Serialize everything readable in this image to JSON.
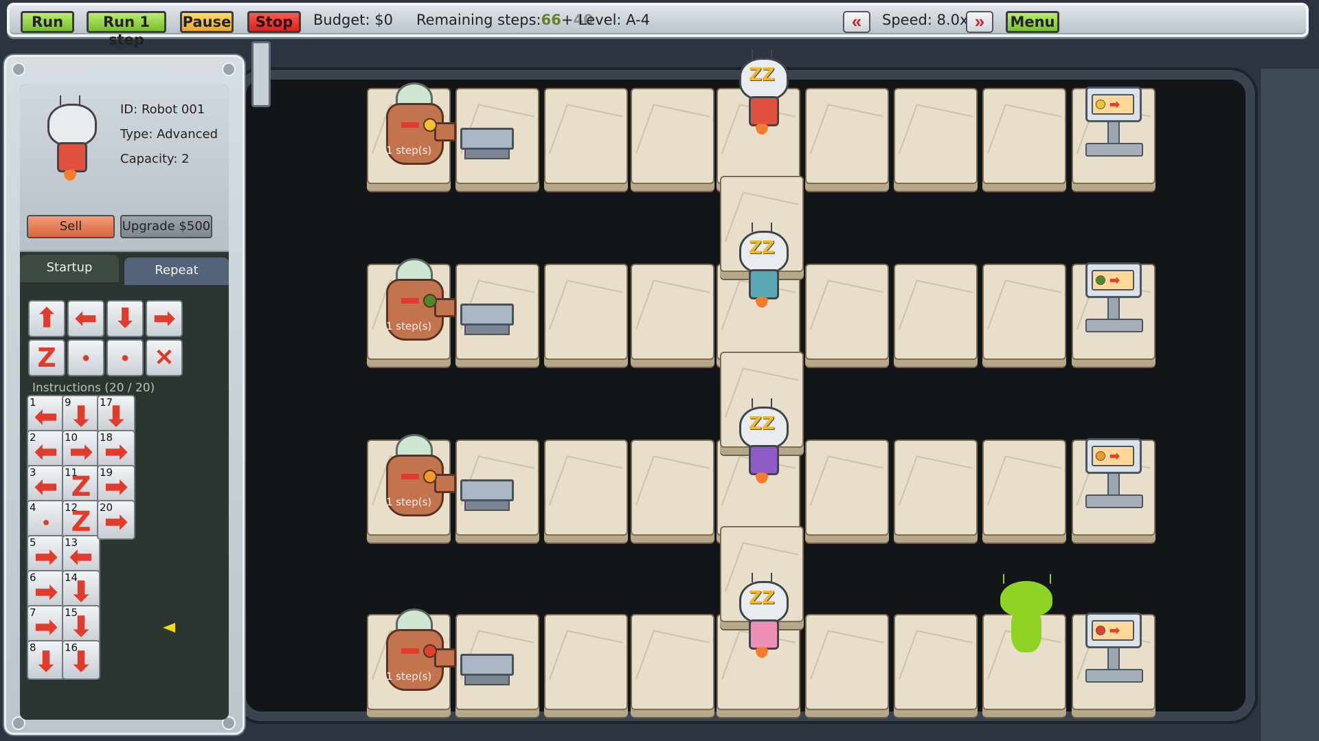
{
  "topbar": {
    "run": "Run",
    "run_one_step": "Run 1 step",
    "pause": "Pause",
    "stop": "Stop",
    "budget": "Budget: $0",
    "remaining_label": "Remaining steps:",
    "remaining_a": "66",
    "remaining_plus": "+",
    "remaining_b": "40",
    "level": "Level: A-4",
    "slower": "«",
    "speed": "Speed: 8.0x",
    "faster": "»",
    "menu": "Menu"
  },
  "robot_info": {
    "id": "ID: Robot 001",
    "type": "Type: Advanced",
    "capacity": "Capacity: 2",
    "sell": "Sell",
    "upgrade": "Upgrade $500"
  },
  "tabs": {
    "startup": "Startup",
    "repeat": "Repeat"
  },
  "palette": [
    {
      "icon": "arrow-up-icon",
      "glyph": "⬆"
    },
    {
      "icon": "arrow-left-icon",
      "glyph": "⬅"
    },
    {
      "icon": "arrow-down-icon",
      "glyph": "⬇"
    },
    {
      "icon": "arrow-right-icon",
      "glyph": "➡"
    },
    {
      "icon": "sleep-icon",
      "glyph": "Z"
    },
    {
      "icon": "grab-icon",
      "glyph": "●"
    },
    {
      "icon": "drop-icon",
      "glyph": "●"
    },
    {
      "icon": "delete-icon",
      "glyph": "✕"
    }
  ],
  "instructions_label": "Instructions (20 / 20)",
  "instructions": [
    {
      "n": "1",
      "icon": "arrow-left-icon",
      "glyph": "⬅"
    },
    {
      "n": "2",
      "icon": "arrow-left-icon",
      "glyph": "⬅"
    },
    {
      "n": "3",
      "icon": "arrow-left-icon",
      "glyph": "⬅"
    },
    {
      "n": "4",
      "icon": "grab-icon",
      "glyph": "●"
    },
    {
      "n": "5",
      "icon": "arrow-right-icon",
      "glyph": "➡"
    },
    {
      "n": "6",
      "icon": "arrow-right-icon",
      "glyph": "➡"
    },
    {
      "n": "7",
      "icon": "arrow-right-icon",
      "glyph": "➡"
    },
    {
      "n": "8",
      "icon": "arrow-down-icon",
      "glyph": "⬇"
    },
    {
      "n": "9",
      "icon": "arrow-down-icon",
      "glyph": "⬇"
    },
    {
      "n": "10",
      "icon": "arrow-right-icon",
      "glyph": "➡"
    },
    {
      "n": "11",
      "icon": "sleep-icon",
      "glyph": "Z"
    },
    {
      "n": "12",
      "icon": "sleep-icon",
      "glyph": "Z"
    },
    {
      "n": "13",
      "icon": "arrow-left-icon",
      "glyph": "⬅"
    },
    {
      "n": "14",
      "icon": "arrow-down-icon",
      "glyph": "⬇"
    },
    {
      "n": "15",
      "icon": "arrow-down-icon",
      "glyph": "⬇"
    },
    {
      "n": "16",
      "icon": "arrow-down-icon",
      "glyph": "⬇"
    },
    {
      "n": "17",
      "icon": "arrow-down-icon",
      "glyph": "⬇"
    },
    {
      "n": "18",
      "icon": "arrow-right-icon",
      "glyph": "➡"
    },
    {
      "n": "19",
      "icon": "arrow-right-icon",
      "glyph": "➡"
    },
    {
      "n": "20",
      "icon": "arrow-right-icon",
      "glyph": "➡"
    }
  ],
  "board": {
    "emitter_steps": "1 step(s)",
    "rows": [
      {
        "fruit": "lemon",
        "fruit_color": "#f2c12e",
        "robot_color": "#e0523e"
      },
      {
        "fruit": "watermelon",
        "fruit_color": "#4f8a2a",
        "robot_color": "#5aa7b5"
      },
      {
        "fruit": "orange",
        "fruit_color": "#f39a27",
        "robot_color": "#8f5bc6"
      },
      {
        "fruit": "apple",
        "fruit_color": "#e0402e",
        "robot_color": "#ee8fb5"
      }
    ]
  },
  "colors": {
    "accent_green": "#79c02e",
    "stop_red": "#d8231c",
    "arrow_red": "#e23b2c"
  }
}
